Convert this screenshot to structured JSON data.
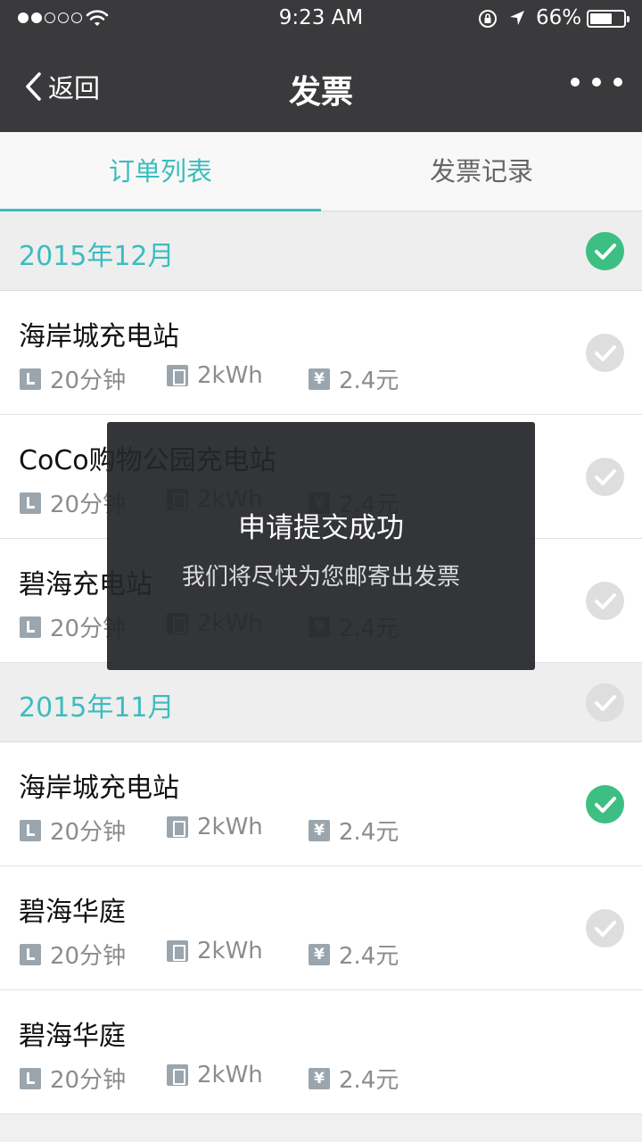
{
  "status_bar": {
    "time": "9:23 AM",
    "battery_percent": "66%",
    "battery_level": 0.66,
    "signal_bars": 2,
    "signal_total": 5
  },
  "nav": {
    "back_label": "返回",
    "title": "发票"
  },
  "tabs": [
    {
      "label": "订单列表",
      "active": true
    },
    {
      "label": "发票记录",
      "active": false
    }
  ],
  "sections": [
    {
      "month": "2015年12月",
      "checked": true,
      "orders": [
        {
          "station": "海岸城充电站",
          "duration": "20分钟",
          "energy": "2kWh",
          "price": "2.4元",
          "checked": false
        },
        {
          "station": "CoCo购物公园充电站",
          "duration": "20分钟",
          "energy": "2kWh",
          "price": "2.4元",
          "checked": false
        },
        {
          "station": "碧海充电站",
          "duration": "20分钟",
          "energy": "2kWh",
          "price": "2.4元",
          "checked": false
        }
      ]
    },
    {
      "month": "2015年11月",
      "checked": false,
      "orders": [
        {
          "station": "海岸城充电站",
          "duration": "20分钟",
          "energy": "2kWh",
          "price": "2.4元",
          "checked": true
        },
        {
          "station": "碧海华庭",
          "duration": "20分钟",
          "energy": "2kWh",
          "price": "2.4元",
          "checked": false
        },
        {
          "station": "碧海华庭",
          "duration": "20分钟",
          "energy": "2kWh",
          "price": "2.4元",
          "checked": null
        }
      ]
    }
  ],
  "toast": {
    "title": "申请提交成功",
    "message": "我们将尽快为您邮寄出发票"
  },
  "icons": {
    "back": "chevron-left-icon",
    "more": "more-dots-icon",
    "duration": "clock-icon",
    "energy": "battery-icon",
    "price": "yen-icon",
    "check": "check-circle-icon"
  },
  "colors": {
    "header_bg": "#3a3a3c",
    "accent": "#3cbcbf",
    "check_on": "#3dbf83",
    "check_off": "#dedede"
  }
}
